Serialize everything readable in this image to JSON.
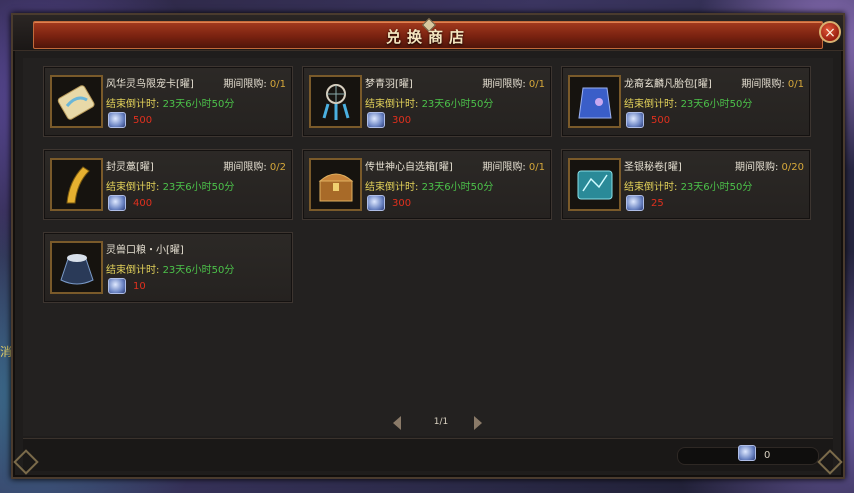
{
  "window": {
    "title": "兑换商店",
    "close_label": "×"
  },
  "items": [
    {
      "name": "风华灵鸟限宠卡[曜]",
      "limit_label": "期间限购:",
      "limit_value": "0/1",
      "timer_label": "结束倒计时:",
      "timer_value": "23天6小时50分",
      "price": "500",
      "icon": "pet-card-icon"
    },
    {
      "name": "梦青羽[曜]",
      "limit_label": "期间限购:",
      "limit_value": "0/1",
      "timer_label": "结束倒计时:",
      "timer_value": "23天6小时50分",
      "price": "300",
      "icon": "dreamcatcher-icon"
    },
    {
      "name": "龙裔玄麟凡胎包[曜]",
      "limit_label": "期间限购:",
      "limit_value": "0/1",
      "timer_label": "结束倒计时:",
      "timer_value": "23天6小时50分",
      "price": "500",
      "icon": "blue-bag-icon"
    },
    {
      "name": "封灵藁[曜]",
      "limit_label": "期间限购:",
      "limit_value": "0/2",
      "timer_label": "结束倒计时:",
      "timer_value": "23天6小时50分",
      "price": "400",
      "icon": "golden-talisman-icon"
    },
    {
      "name": "传世神心自选箱[曜]",
      "limit_label": "期间限购:",
      "limit_value": "0/1",
      "timer_label": "结束倒计时:",
      "timer_value": "23天6小时50分",
      "price": "300",
      "icon": "treasure-chest-icon"
    },
    {
      "name": "圣银秘卷[曜]",
      "limit_label": "期间限购:",
      "limit_value": "0/20",
      "timer_label": "结束倒计时:",
      "timer_value": "23天6小时50分",
      "price": "25",
      "icon": "star-scroll-icon"
    },
    {
      "name": "灵兽口粮・小[曜]",
      "limit_label": "",
      "limit_value": "",
      "timer_label": "结束倒计时:",
      "timer_value": "23天6小时50分",
      "price": "10",
      "icon": "food-sack-icon"
    }
  ],
  "pager": {
    "page": "1/1"
  },
  "balance": {
    "value": "0",
    "icon": "crystal-currency-icon"
  },
  "colors": {
    "title_red": "#7a2210",
    "price_red": "#e0301e",
    "timer_green": "#4cc24a",
    "label_yellow": "#e3d25a",
    "limit_gold": "#d6a83a"
  }
}
